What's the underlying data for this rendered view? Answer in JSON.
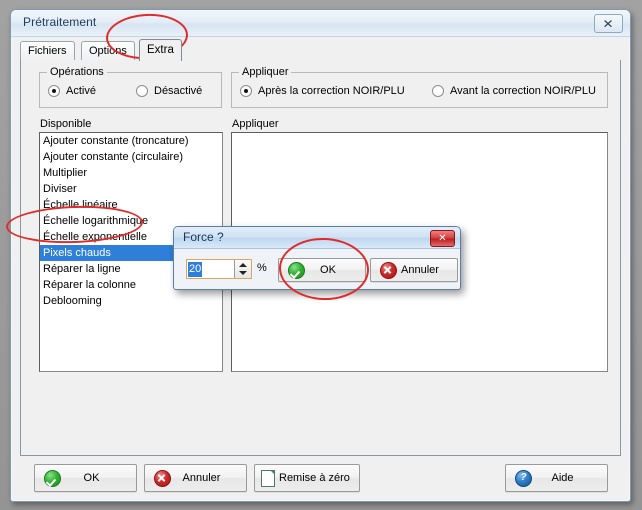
{
  "window": {
    "title": "Prétraitement",
    "close_label": "✕"
  },
  "tabs": [
    {
      "label": "Fichiers",
      "selected": false
    },
    {
      "label": "Options",
      "selected": false
    },
    {
      "label": "Extra",
      "selected": true
    }
  ],
  "operations_group": {
    "legend": "Opérations",
    "options": [
      {
        "label": "Activé",
        "checked": true
      },
      {
        "label": "Désactivé",
        "checked": false
      }
    ]
  },
  "apply_group": {
    "legend": "Appliquer",
    "options": [
      {
        "label": "Après la correction NOIR/PLU",
        "checked": true
      },
      {
        "label": "Avant la correction NOIR/PLU",
        "checked": false
      }
    ]
  },
  "available_list": {
    "label": "Disponible",
    "items": [
      {
        "label": "Ajouter constante (troncature)",
        "selected": false
      },
      {
        "label": "Ajouter constante (circulaire)",
        "selected": false
      },
      {
        "label": "Multiplier",
        "selected": false
      },
      {
        "label": "Diviser",
        "selected": false
      },
      {
        "label": "Échelle linéaire",
        "selected": false
      },
      {
        "label": "Échelle logarithmique",
        "selected": false
      },
      {
        "label": "Échelle exponentielle",
        "selected": false
      },
      {
        "label": "Pixels chauds",
        "selected": true
      },
      {
        "label": "Réparer la ligne",
        "selected": false
      },
      {
        "label": "Réparer la colonne",
        "selected": false
      },
      {
        "label": "Deblooming",
        "selected": false
      }
    ]
  },
  "applied_list": {
    "label": "Appliquer",
    "items": []
  },
  "bottom_bar": {
    "ok_label": "OK",
    "cancel_label": "Annuler",
    "reset_label": "Remise à zéro",
    "help_label": "Aide",
    "help_glyph": "?"
  },
  "modal": {
    "title": "Force ?",
    "close_label": "✕",
    "value": "20",
    "unit": "%",
    "ok_label": "OK",
    "cancel_label": "Annuler"
  },
  "colors": {
    "selection_blue": "#2d7fd9",
    "annotation_red": "#e02b2b",
    "ok_green": "#34b334",
    "cancel_red": "#cf2b2b",
    "help_blue": "#2f7fc9",
    "desktop_gray": "#9b9b9b"
  }
}
